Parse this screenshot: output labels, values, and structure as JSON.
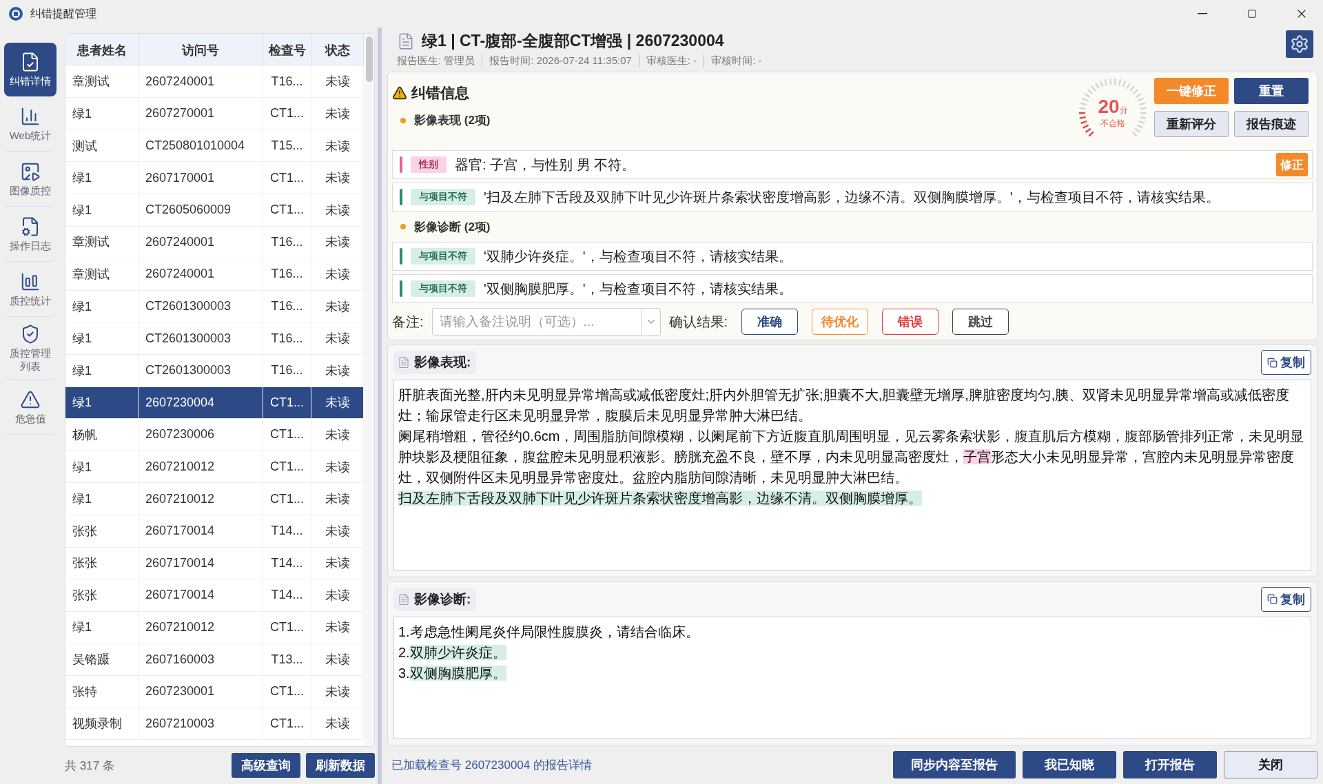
{
  "window": {
    "title": "纠错提醒管理"
  },
  "sidebar": {
    "items": [
      {
        "label": "纠错详情",
        "selected": true
      },
      {
        "label": "Web统计",
        "selected": false
      },
      {
        "label": "图像质控",
        "selected": false
      },
      {
        "label": "操作日志",
        "selected": false
      },
      {
        "label": "质控统计",
        "selected": false
      },
      {
        "label": "质控管理列表",
        "selected": false
      },
      {
        "label": "危急值",
        "selected": false
      }
    ]
  },
  "table": {
    "columns": [
      "患者姓名",
      "访问号",
      "检查号",
      "状态"
    ],
    "rows": [
      {
        "cells": [
          "章测试",
          "2607240001",
          "T16...",
          "未读"
        ],
        "selected": false
      },
      {
        "cells": [
          "绿1",
          "2607270001",
          "CT1...",
          "未读"
        ],
        "selected": false
      },
      {
        "cells": [
          "测试",
          "CT250801010004",
          "T15...",
          "未读"
        ],
        "selected": false
      },
      {
        "cells": [
          "绿1",
          "2607170001",
          "CT1...",
          "未读"
        ],
        "selected": false
      },
      {
        "cells": [
          "绿1",
          "CT2605060009",
          "CT1...",
          "未读"
        ],
        "selected": false
      },
      {
        "cells": [
          "章测试",
          "2607240001",
          "T16...",
          "未读"
        ],
        "selected": false
      },
      {
        "cells": [
          "章测试",
          "2607240001",
          "T16...",
          "未读"
        ],
        "selected": false
      },
      {
        "cells": [
          "绿1",
          "CT2601300003",
          "T16...",
          "未读"
        ],
        "selected": false
      },
      {
        "cells": [
          "绿1",
          "CT2601300003",
          "T16...",
          "未读"
        ],
        "selected": false
      },
      {
        "cells": [
          "绿1",
          "CT2601300003",
          "T16...",
          "未读"
        ],
        "selected": false
      },
      {
        "cells": [
          "绿1",
          "2607230004",
          "CT1...",
          "未读"
        ],
        "selected": true
      },
      {
        "cells": [
          "杨帆",
          "2607230006",
          "CT1...",
          "未读"
        ],
        "selected": false
      },
      {
        "cells": [
          "绿1",
          "2607210012",
          "CT1...",
          "未读"
        ],
        "selected": false
      },
      {
        "cells": [
          "绿1",
          "2607210012",
          "CT1...",
          "未读"
        ],
        "selected": false
      },
      {
        "cells": [
          "张张",
          "2607170014",
          "T14...",
          "未读"
        ],
        "selected": false
      },
      {
        "cells": [
          "张张",
          "2607170014",
          "T14...",
          "未读"
        ],
        "selected": false
      },
      {
        "cells": [
          "张张",
          "2607170014",
          "T14...",
          "未读"
        ],
        "selected": false
      },
      {
        "cells": [
          "绿1",
          "2607210012",
          "CT1...",
          "未读"
        ],
        "selected": false
      },
      {
        "cells": [
          "吴铬蹑",
          "2607160003",
          "T13...",
          "未读"
        ],
        "selected": false
      },
      {
        "cells": [
          "张特",
          "2607230001",
          "CT1...",
          "未读"
        ],
        "selected": false
      },
      {
        "cells": [
          "视频录制",
          "2607210003",
          "CT1...",
          "未读"
        ],
        "selected": false
      }
    ],
    "count": "共 317 条",
    "buttons": [
      "高级查询",
      "刷新数据"
    ]
  },
  "report": {
    "title": "绿1 | CT-腹部-全腹部CT增强 | 2607230004",
    "meta": [
      "报告医生: 管理员",
      "报告时间: 2026-07-24 11:35:07",
      "审核医生: -",
      "审核时间: -"
    ]
  },
  "errors": {
    "title": "纠错信息",
    "score": {
      "value": "20",
      "unit": "分",
      "verdict": "不合格",
      "level": 0.2
    },
    "actions": [
      {
        "label": "一键修正",
        "kind": "accent"
      },
      {
        "label": "重置",
        "kind": "primary"
      },
      {
        "label": "重新评分",
        "kind": "light"
      },
      {
        "label": "报告痕迹",
        "kind": "light"
      }
    ],
    "sections": [
      {
        "title": "影像表现 (2项)",
        "items": [
          {
            "tag": "性别",
            "kind": "sex",
            "text": "器官: 子宫，与性别 男 不符。",
            "fix": "修正"
          },
          {
            "tag": "与项目不符",
            "kind": "mismatch",
            "text": "'扫及左肺下舌段及双肺下叶见少许斑片条索状密度增高影，边缘不清。双侧胸膜增厚。'，与检查项目不符，请核实结果。"
          }
        ]
      },
      {
        "title": "影像诊断 (2项)",
        "items": [
          {
            "tag": "与项目不符",
            "kind": "mismatch",
            "text": "'双肺少许炎症。'，与检查项目不符，请核实结果。"
          },
          {
            "tag": "与项目不符",
            "kind": "mismatch",
            "text": "'双侧胸膜肥厚。'，与检查项目不符，请核实结果。"
          }
        ]
      }
    ],
    "note_label": "备注:",
    "note_placeholder": "请输入备注说明（可选）...",
    "confirm_label": "确认结果:",
    "confirm": [
      {
        "label": "准确",
        "kind": "blue"
      },
      {
        "label": "待优化",
        "kind": "orange"
      },
      {
        "label": "错误",
        "kind": "red"
      },
      {
        "label": "跳过",
        "kind": "gray"
      }
    ]
  },
  "panels": [
    {
      "title": "影像表现:",
      "copy": "复制",
      "paragraphs": [
        [
          {
            "text": "肝脏表面光整,肝内未见明显异常增高或减低密度灶;肝内外胆管无扩张;胆囊不大,胆囊壁无增厚,脾脏密度均匀,胰、双肾未见明显异常增高或减低密度灶；输尿管走行区未见明显异常，腹膜后未见明显异常肿大淋巴结。",
            "kind": "plain"
          }
        ],
        [
          {
            "text": "阑尾稍增粗，管径约0.6cm，周围脂肪间隙模糊，以阑尾前下方近腹直肌周围明显，见云雾条索状影，腹直肌后方模糊，腹部肠管排列正常，未见明显肿块影及梗阻征象，腹盆腔未见明显积液影。膀胱充盈不良，壁不厚，内未见明显高密度灶，",
            "kind": "plain"
          },
          {
            "text": "子宫",
            "kind": "sex"
          },
          {
            "text": "形态大小未见明显异常，宫腔内未见明显异常密度灶，双侧附件区未见明显异常密度灶。盆腔内脂肪间隙清晰，未见明显肿大淋巴结。",
            "kind": "plain"
          }
        ],
        [
          {
            "text": "扫及左肺下舌段及双肺下叶见少许斑片条索状密度增高影，边缘不清。双侧胸膜增厚。",
            "kind": "mismatch"
          }
        ]
      ]
    },
    {
      "title": "影像诊断:",
      "copy": "复制",
      "paragraphs": [
        [
          {
            "text": "1.考虑急性阑尾炎伴局限性腹膜炎，请结合临床。",
            "kind": "plain"
          }
        ],
        [
          {
            "text": "2.",
            "kind": "plain"
          },
          {
            "text": "双肺少许炎症。",
            "kind": "mismatch"
          }
        ],
        [
          {
            "text": "3.",
            "kind": "plain"
          },
          {
            "text": "双侧胸膜肥厚。",
            "kind": "mismatch"
          }
        ]
      ]
    }
  ],
  "status_bar": {
    "message": "已加载检查号 2607230004 的报告详情",
    "buttons": [
      {
        "label": "同步内容至报告",
        "kind": "primary"
      },
      {
        "label": "我已知晓",
        "kind": "primary"
      },
      {
        "label": "打开报告",
        "kind": "primary"
      },
      {
        "label": "关闭",
        "kind": "light"
      }
    ]
  }
}
